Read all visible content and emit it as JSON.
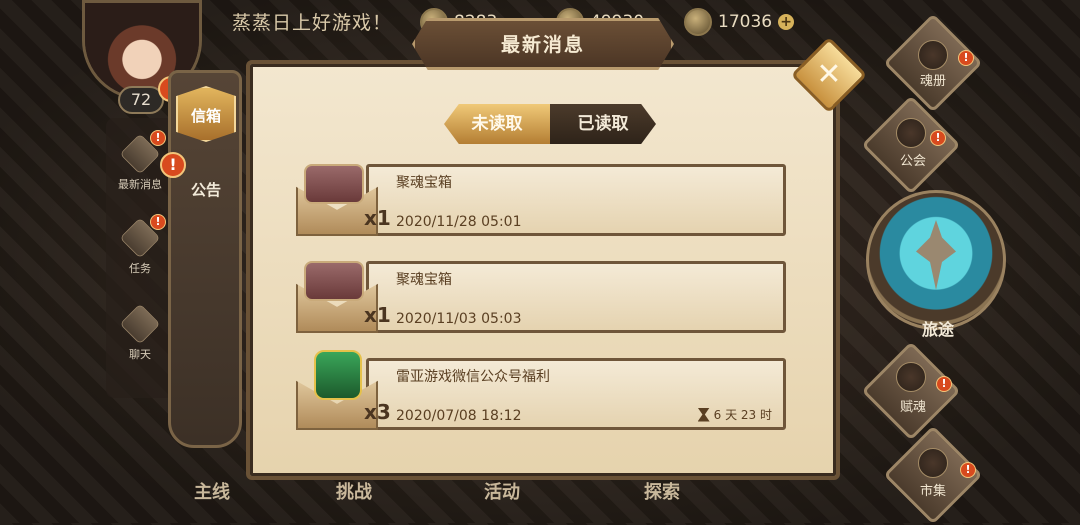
{
  "topbar": {
    "greeting": "蒸蒸日上好游戏！",
    "currency_1": "8283",
    "currency_2": "49930",
    "currency_3": "17036",
    "plus": "+"
  },
  "player": {
    "level": "72"
  },
  "alerts": {
    "mark": "!"
  },
  "left_rail": {
    "items": [
      {
        "label": "最新消息"
      },
      {
        "label": "任务"
      },
      {
        "label": "聊天"
      }
    ]
  },
  "tabs": {
    "inbox": "信箱",
    "notice": "公告"
  },
  "dialog": {
    "title": "最新消息",
    "close_glyph": "✕",
    "segments": {
      "unread": "未读取",
      "read": "已读取"
    }
  },
  "messages": [
    {
      "title": "聚魂宝箱",
      "qty": "x1",
      "date": "2020/11/28 05:01",
      "icon": "chest-icon"
    },
    {
      "title": "聚魂宝箱",
      "qty": "x1",
      "date": "2020/11/03 05:03",
      "icon": "chest-icon"
    },
    {
      "title": "雷亚游戏微信公众号福利",
      "qty": "x3",
      "date": "2020/07/08 18:12",
      "timer": "6 天 23 时",
      "icon": "gift-icon"
    }
  ],
  "right_nav": {
    "soul_book": "魂册",
    "guild": "公会",
    "journey": "旅途",
    "soul_gift": "赋魂",
    "market": "市集"
  },
  "bottom_nav": {
    "main": "主线",
    "challenge": "挑战",
    "activity": "活动",
    "explore": "探索"
  },
  "colors": {
    "accent_gold": "#d6b25a",
    "alert_red": "#d84a1e",
    "parchment": "#f3e7cf",
    "frame_brown": "#6a5236"
  }
}
